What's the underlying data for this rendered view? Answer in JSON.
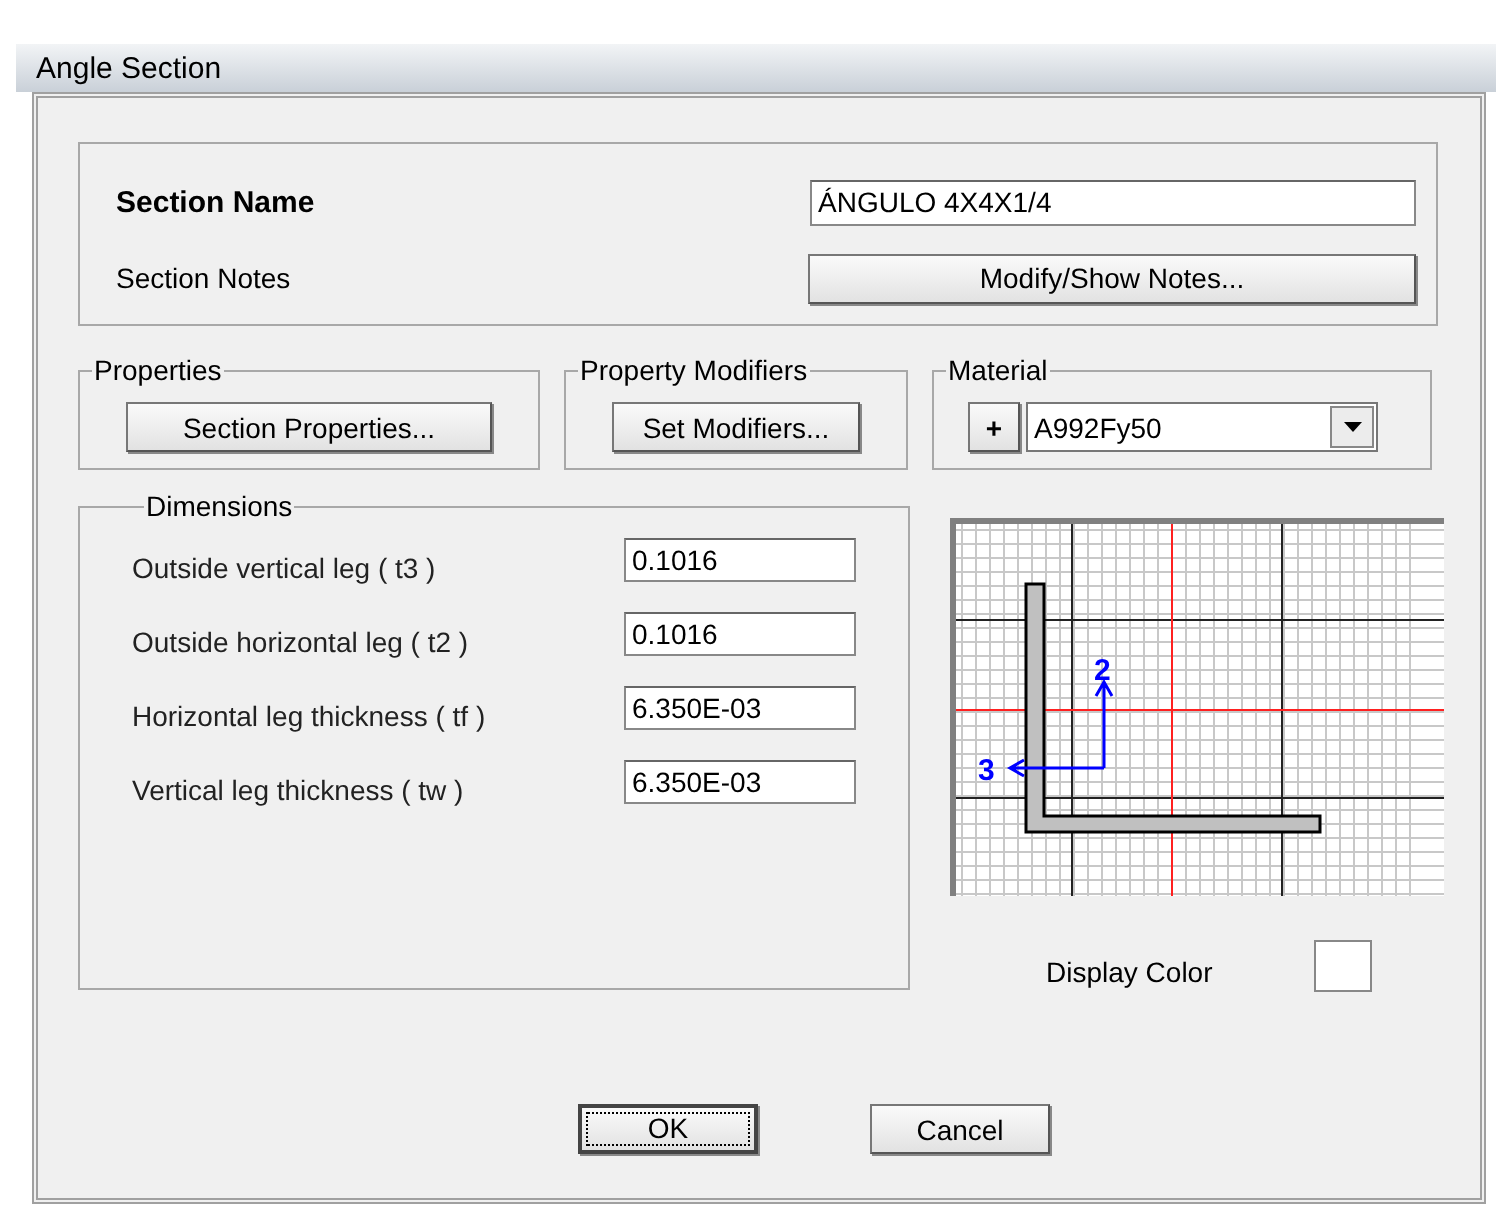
{
  "window": {
    "title": "Angle Section"
  },
  "section": {
    "name_label": "Section Name",
    "name_value": "ÁNGULO 4X4X1/4",
    "notes_label": "Section Notes",
    "notes_button": "Modify/Show Notes..."
  },
  "properties": {
    "title": "Properties",
    "button": "Section Properties..."
  },
  "property_modifiers": {
    "title": "Property Modifiers",
    "button": "Set Modifiers..."
  },
  "material": {
    "title": "Material",
    "add_button": "+",
    "value": "A992Fy50"
  },
  "dimensions": {
    "title": "Dimensions",
    "fields": [
      {
        "label": "Outside vertical leg  ( t3 )",
        "value": "0.1016"
      },
      {
        "label": "Outside horizontal leg  ( t2 )",
        "value": "0.1016"
      },
      {
        "label": "Horizontal leg thickness  ( tf )",
        "value": "6.350E-03"
      },
      {
        "label": "Vertical leg thickness  ( tw )",
        "value": "6.350E-03"
      }
    ]
  },
  "diagram": {
    "axis_labels": [
      "2",
      "3"
    ]
  },
  "display_color": {
    "label": "Display Color",
    "color": "#ffffff"
  },
  "buttons": [
    {
      "label": "OK",
      "focused": true
    },
    {
      "label": "Cancel",
      "focused": false
    }
  ]
}
